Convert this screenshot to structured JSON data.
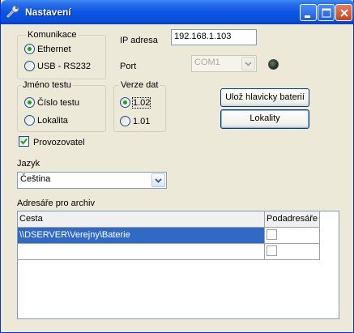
{
  "window": {
    "title": "Nastavení"
  },
  "komunikace": {
    "label": "Komunikace",
    "options": [
      {
        "label": "Ethernet",
        "checked": true
      },
      {
        "label": "USB - RS232",
        "checked": false
      }
    ]
  },
  "ip": {
    "label": "IP adresa",
    "value": "192.168.1.103"
  },
  "port": {
    "label": "Port",
    "value": "COM1",
    "disabled": true
  },
  "jmeno_testu": {
    "label": "Jméno testu",
    "options": [
      {
        "label": "Číslo testu",
        "checked": true
      },
      {
        "label": "Lokalita",
        "checked": false
      }
    ]
  },
  "verze_dat": {
    "label": "Verze dat",
    "options": [
      {
        "label": "1.02",
        "checked": true
      },
      {
        "label": "1.01",
        "checked": false
      }
    ]
  },
  "buttons": {
    "save_headers": "Ulož hlavicky baterií",
    "locations": "Lokality"
  },
  "provozovatel": {
    "label": "Provozovatel",
    "checked": true
  },
  "jazyk": {
    "label": "Jazyk",
    "value": "Čeština"
  },
  "archiv": {
    "label": "Adresáře pro archiv",
    "columns": [
      "Cesta",
      "Podadresáře"
    ],
    "rows": [
      {
        "cesta": "\\\\DSERVER\\Verejny\\Baterie",
        "podadresare": false,
        "selected": true
      },
      {
        "cesta": "",
        "podadresare": false,
        "selected": false
      }
    ]
  },
  "colors": {
    "titlebar": "#0A4ED8",
    "selection": "#316AC5",
    "radio_check": "#21A121"
  }
}
